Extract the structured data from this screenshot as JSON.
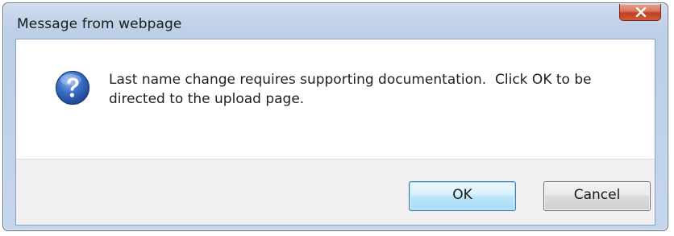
{
  "dialog": {
    "title": "Message from webpage",
    "close_label": "x",
    "icon": "question-icon",
    "message_line1": "Last name change requires supporting documentation.  Click OK to be",
    "message_line2": "directed to the upload page.",
    "buttons": {
      "ok_label": "OK",
      "cancel_label": "Cancel"
    }
  },
  "colors": {
    "titlebar": "#c3d3ea",
    "close_button": "#c2401f",
    "ok_border": "#3c7fb1",
    "button_area": "#f0f0f0",
    "question_icon": "#2a5db0"
  }
}
